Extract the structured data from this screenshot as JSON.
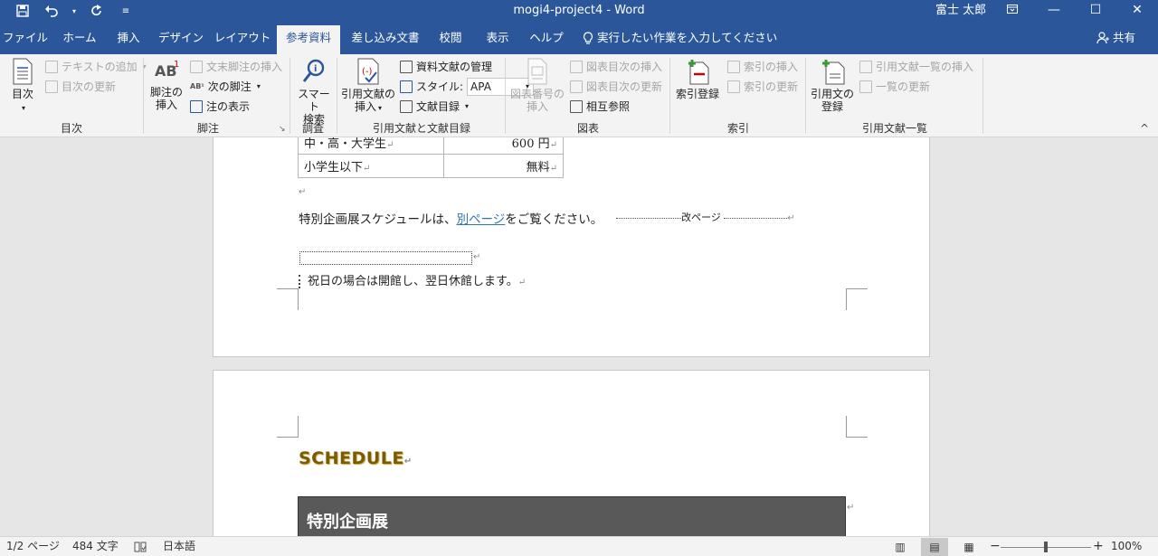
{
  "window": {
    "title": "mogi4-project4 - Word",
    "user": "富士 太郎"
  },
  "tabs": [
    "ファイル",
    "ホーム",
    "挿入",
    "デザイン",
    "レイアウト",
    "参考資料",
    "差し込み文書",
    "校閲",
    "表示",
    "ヘルプ"
  ],
  "active_tab": "参考資料",
  "tell_me": "実行したい作業を入力してください",
  "share": "共有",
  "ribbon": {
    "toc": {
      "big": "目次",
      "add_text": "テキストの追加",
      "update": "目次の更新",
      "label": "目次"
    },
    "footnotes": {
      "insert_l1": "脚注の",
      "insert_l2": "挿入",
      "endnote": "文末脚注の挿入",
      "next": "次の脚注",
      "show": "注の表示",
      "label": "脚注"
    },
    "research": {
      "l1": "スマート",
      "l2": "検索",
      "label": "調査"
    },
    "citations": {
      "insert_l1": "引用文献の",
      "insert_l2": "挿入",
      "manage": "資料文献の管理",
      "style_label": "スタイル:",
      "style_value": "APA",
      "bibliography": "文献目録",
      "label": "引用文献と文献目録"
    },
    "captions": {
      "insert_l1": "図表番号の",
      "insert_l2": "挿入",
      "insert_tof": "図表目次の挿入",
      "update_tof": "図表目次の更新",
      "cross_ref": "相互参照",
      "label": "図表"
    },
    "index": {
      "mark": "索引登録",
      "insert": "索引の挿入",
      "update": "索引の更新",
      "label": "索引"
    },
    "toa": {
      "mark_l1": "引用文の",
      "mark_l2": "登録",
      "insert": "引用文献一覧の挿入",
      "update": "一覧の更新",
      "label": "引用文献一覧"
    }
  },
  "document": {
    "table_rows": [
      {
        "category": "中・高・大学生",
        "price": "600 円"
      },
      {
        "category": "小学生以下",
        "price": "無料"
      }
    ],
    "sentence_before": "特別企画展スケジュールは、",
    "link_text": "別ページ",
    "sentence_after": "をご覧ください。",
    "page_break": "改ページ",
    "holiday_note": "祝日の場合は開館し、翌日休館します。",
    "schedule_heading": "SCHEDULE",
    "special_exhibit": "特別企画展"
  },
  "status": {
    "page": "1/2 ページ",
    "words": "484 文字",
    "language": "日本語",
    "zoom": "100%"
  },
  "colors": {
    "title_bar": "#2b579a",
    "ribbon": "#f3f3f3",
    "link": "#2e75b6",
    "schedule_heading": "#7a5c00",
    "dark_bar": "#595959"
  }
}
